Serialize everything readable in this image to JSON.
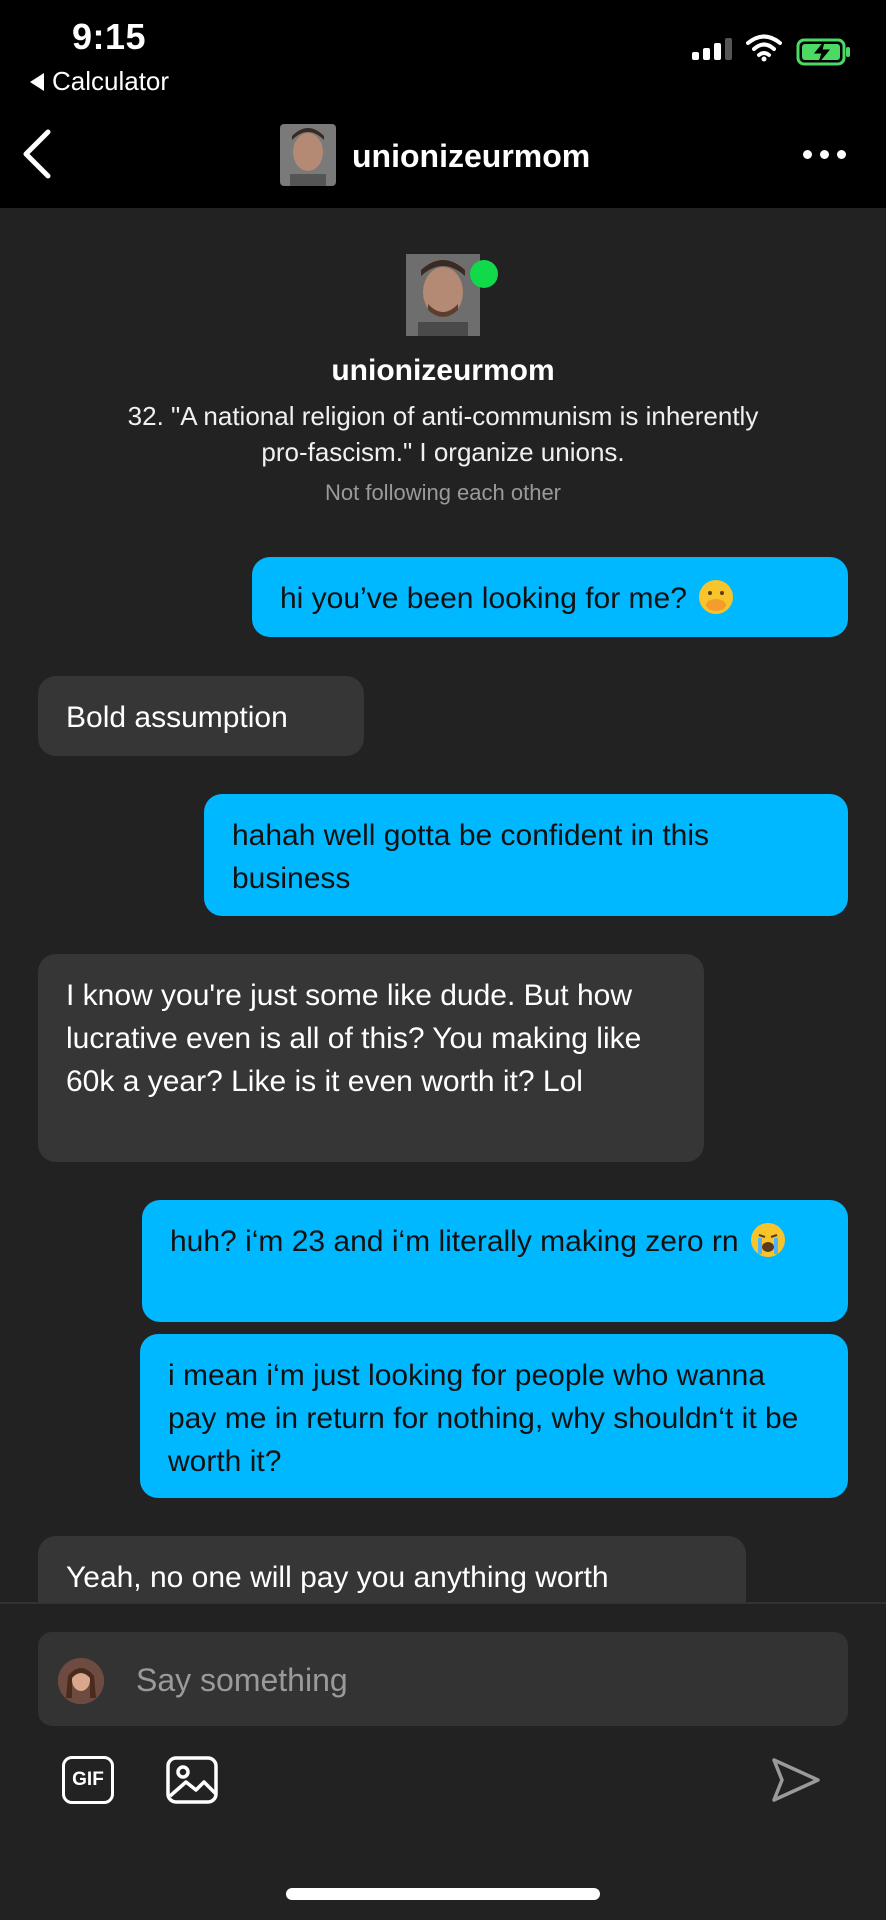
{
  "status_bar": {
    "time": "9:15",
    "back_app": "Calculator"
  },
  "header": {
    "username": "unionizeurmom"
  },
  "profile": {
    "name": "unionizeurmom",
    "bio": "32. \"A national religion of anti-communism is inherently pro-fascism.\" I organize unions.",
    "follow_status": "Not following each other"
  },
  "messages": [
    {
      "text": "hi you’ve been looking for me?",
      "emoji": "face-with-hand-over-mouth"
    },
    {
      "text": "Bold assumption"
    },
    {
      "text": "hahah well gotta be confident in this business"
    },
    {
      "text": "I know you're just some like dude. But how lucrative even is all of this? You making like 60k a year? Like is it even worth it? Lol"
    },
    {
      "text": "huh? i‘m 23 and i‘m literally making zero rn",
      "emoji": "loudly-crying-face"
    },
    {
      "text": "i mean i‘m just looking for people who wanna pay me in return for nothing, why shouldn‘t it be worth it?"
    },
    {
      "text": "Yeah, no one will pay you anything worth"
    }
  ],
  "composer": {
    "placeholder": "Say something",
    "gif_label": "GIF"
  },
  "colors": {
    "outgoing": "#00b8ff",
    "incoming": "#363636",
    "online": "#10d94a",
    "background": "#222222"
  }
}
